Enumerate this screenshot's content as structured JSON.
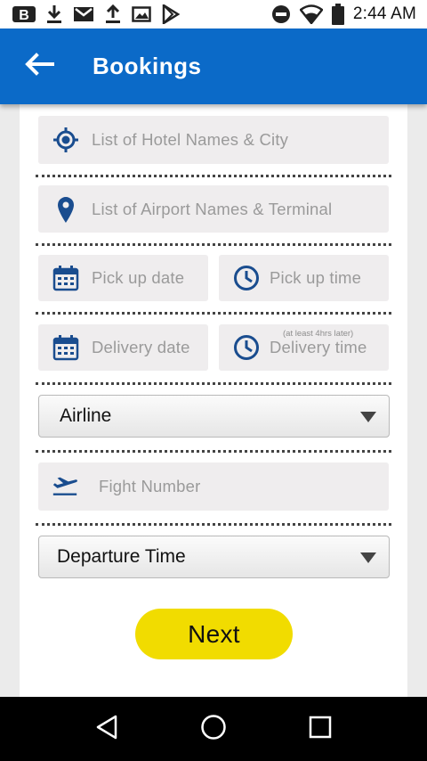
{
  "status_bar": {
    "time": "2:44 AM",
    "left_icons": [
      "b-app-icon",
      "download-icon",
      "gmail-icon",
      "upload-icon",
      "image-icon",
      "play-store-icon"
    ],
    "right_icons": [
      "do-not-disturb-icon",
      "wifi-icon",
      "battery-icon"
    ]
  },
  "app_bar": {
    "title": "Bookings",
    "back_icon": "arrow-left-icon",
    "color": "#0b6ac8"
  },
  "form": {
    "hotel": {
      "placeholder": "List of Hotel Names & City",
      "icon": "location-target-icon"
    },
    "airport": {
      "placeholder": "List of Airport Names & Terminal",
      "icon": "map-pin-icon"
    },
    "pickup_date": {
      "placeholder": "Pick up date",
      "icon": "calendar-icon"
    },
    "pickup_time": {
      "placeholder": "Pick up time",
      "icon": "clock-icon"
    },
    "delivery_date": {
      "placeholder": "Delivery date",
      "icon": "calendar-icon"
    },
    "delivery_time": {
      "placeholder": "Delivery time",
      "hint": "(at least 4hrs later)",
      "icon": "clock-icon"
    },
    "airline": {
      "value": "Airline"
    },
    "flight_number": {
      "placeholder": "Fight Number",
      "icon": "airplane-takeoff-icon"
    },
    "departure_time": {
      "value": "Departure Time"
    },
    "next_label": "Next",
    "accent_color": "#f1dc00",
    "icon_color": "#1a4d8f"
  },
  "nav_bar": {
    "buttons": [
      "back-triangle-icon",
      "home-circle-icon",
      "recents-square-icon"
    ]
  }
}
